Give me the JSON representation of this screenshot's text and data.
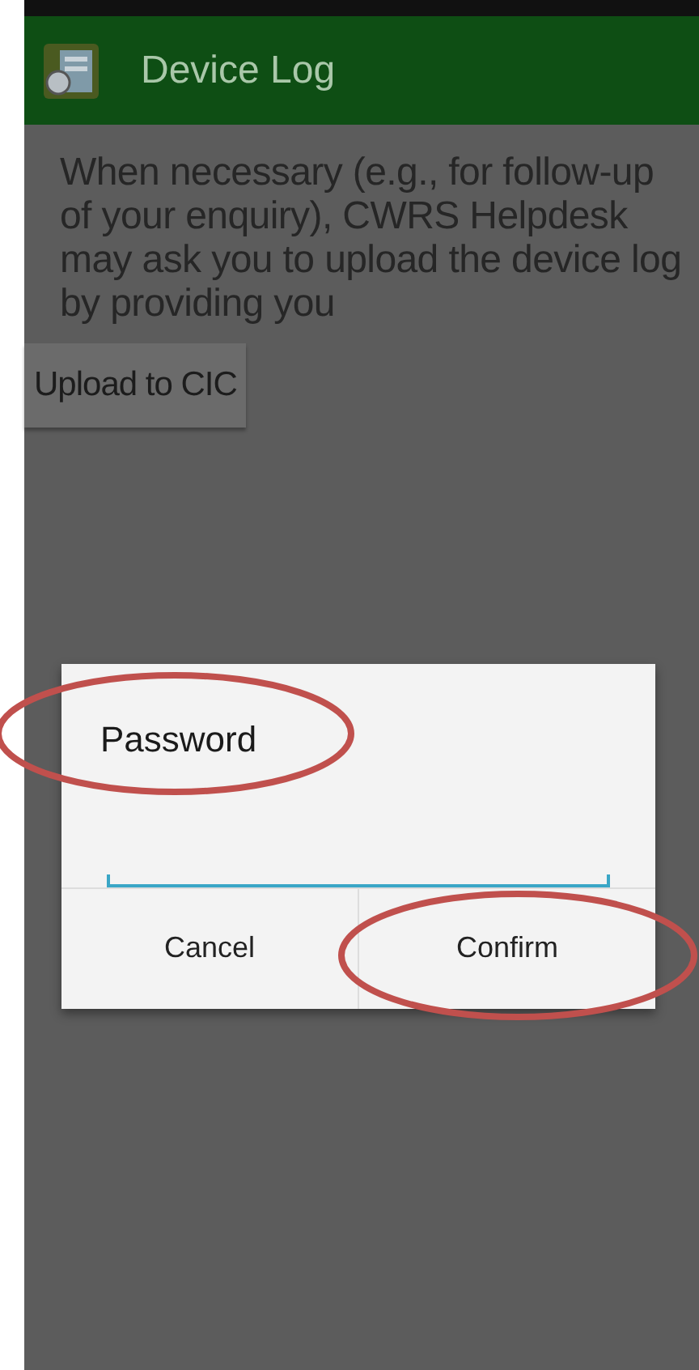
{
  "app_bar": {
    "title": "Device Log"
  },
  "body": {
    "text": "When necessary (e.g., for follow-up of your enquiry), CWRS Helpdesk may ask you to upload the device log by providing you",
    "button": "Upload to CIC"
  },
  "dialog": {
    "title": "Password",
    "field": {
      "focused": true
    },
    "buttons": [
      {
        "label": "Cancel"
      },
      {
        "label": "Confirm"
      }
    ]
  }
}
